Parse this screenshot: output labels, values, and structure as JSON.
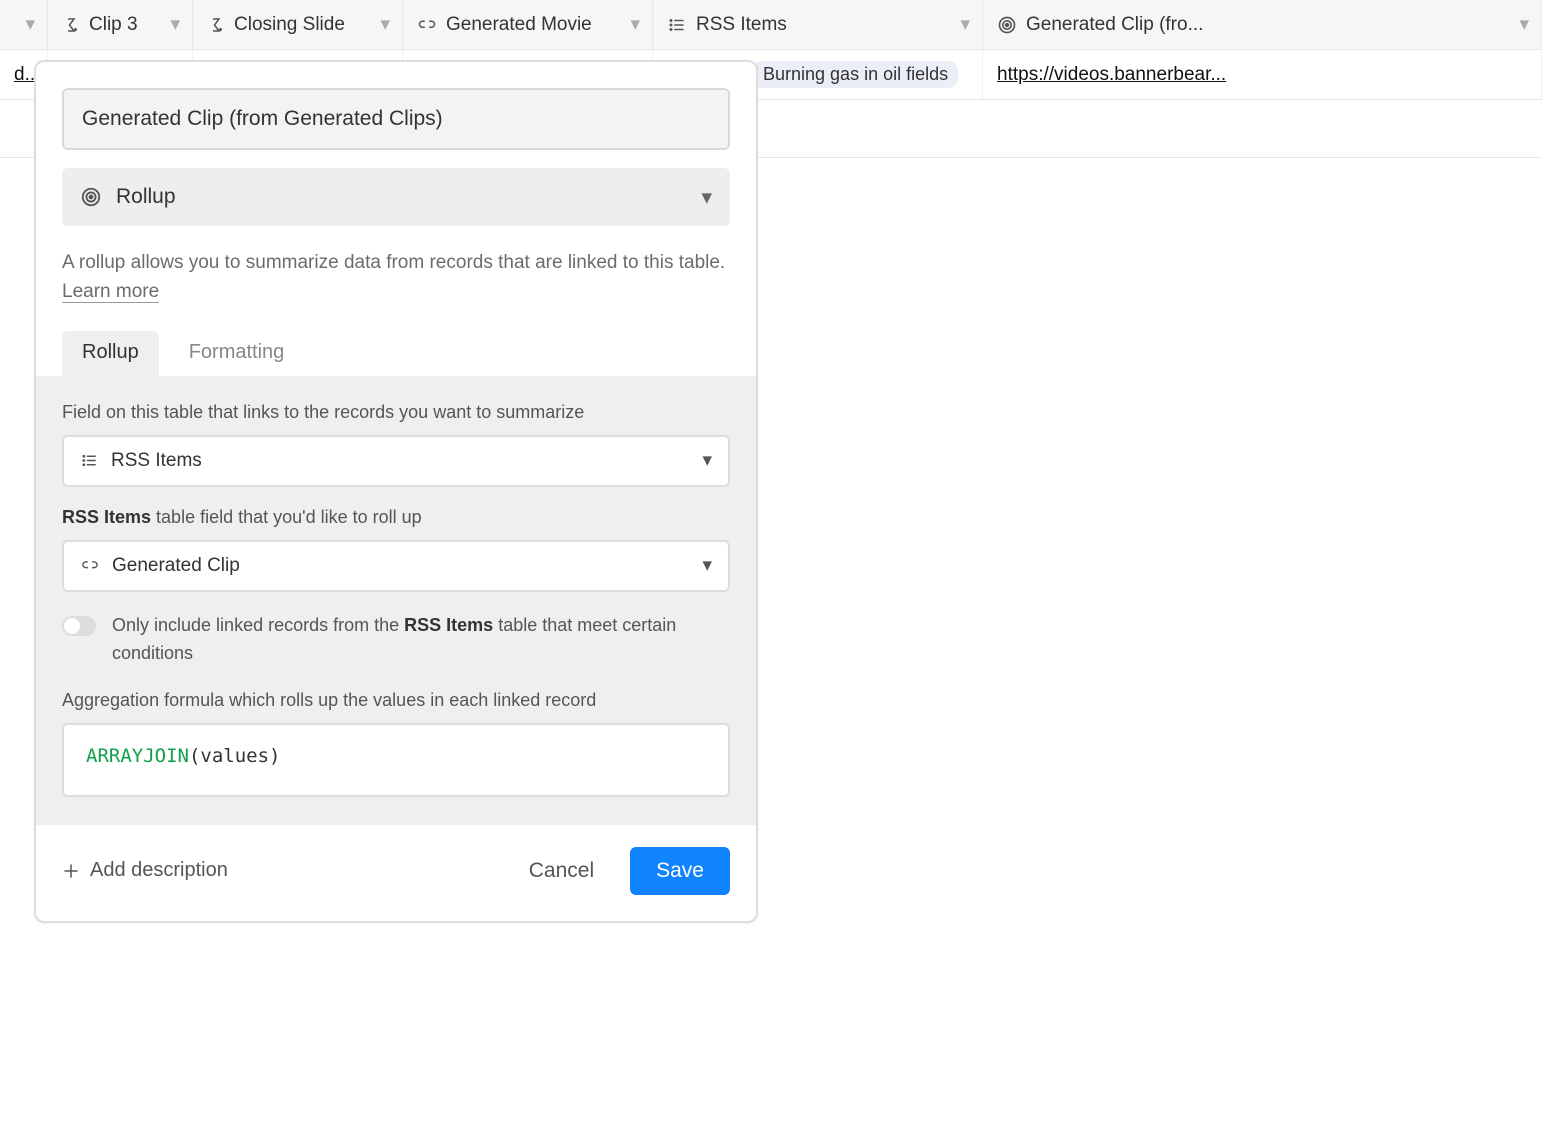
{
  "columns": {
    "clip3": "Clip 3",
    "closing": "Closing Slide",
    "genmovie": "Generated Movie",
    "rss": "RSS Items",
    "genclip": "Generated Clip (fro..."
  },
  "row": {
    "truncated_left": "d...",
    "rss_pill": "Burning gas in oil fields",
    "genclip_link": "https://videos.bannerbear..."
  },
  "popover": {
    "name": "Generated Clip (from Generated Clips)",
    "type_label": "Rollup",
    "description_prefix": "A rollup allows you to summarize data from records that are linked to this table. ",
    "learn_more": "Learn more",
    "tabs": {
      "rollup": "Rollup",
      "formatting": "Formatting"
    },
    "label_link_field": "Field on this table that links to the records you want to summarize",
    "link_field_value": "RSS Items",
    "label_target_prefix": "RSS Items",
    "label_target_suffix": " table field that you'd like to roll up",
    "target_field_value": "Generated Clip",
    "toggle_text_prefix": "Only include linked records from the ",
    "toggle_text_bold": "RSS Items",
    "toggle_text_suffix": " table that meet certain conditions",
    "label_agg": "Aggregation formula which rolls up the values in each linked record",
    "formula": {
      "fn": "ARRAYJOIN",
      "arg": "values"
    },
    "add_description": "Add description",
    "cancel": "Cancel",
    "save": "Save"
  }
}
